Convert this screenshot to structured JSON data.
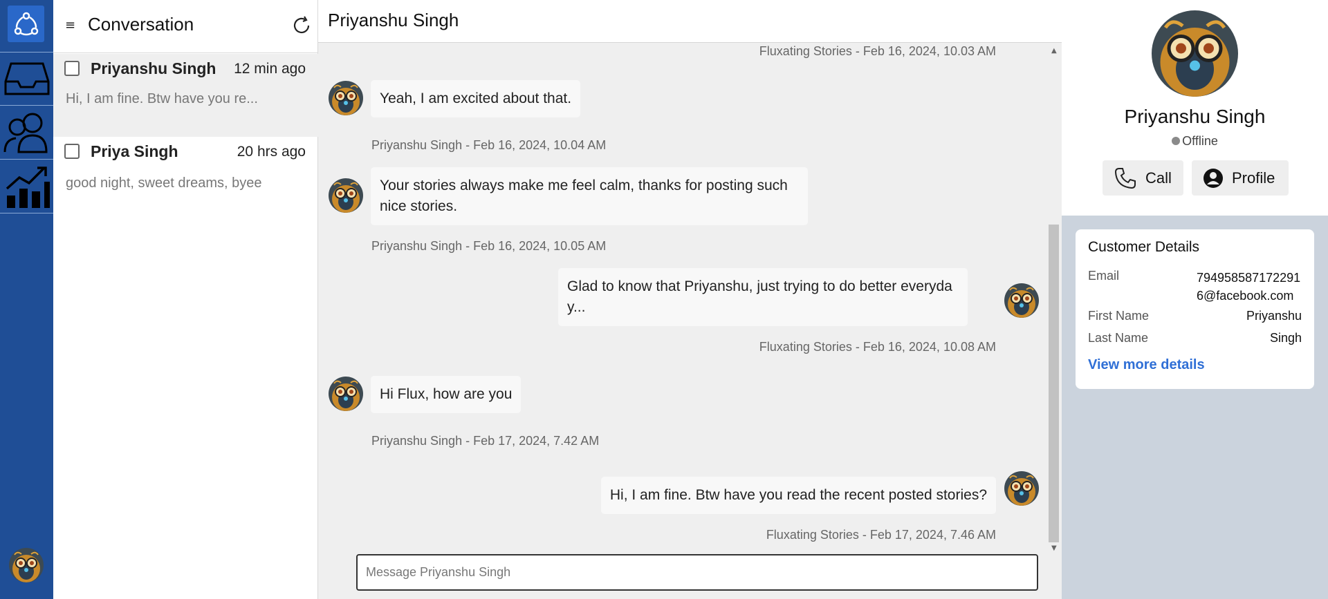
{
  "conversation_list": {
    "title": "Conversation",
    "items": [
      {
        "name": "Priyanshu Singh",
        "time": "12 min ago",
        "preview": "Hi, I am fine. Btw have you re..."
      },
      {
        "name": "Priya Singh",
        "time": "20 hrs ago",
        "preview": "good night, sweet dreams, byee"
      }
    ]
  },
  "chat": {
    "title": "Priyanshu Singh",
    "messages": [
      {
        "meta": "Fluxating Stories - Feb 16, 2024, 10.03 AM"
      },
      {
        "text": "Yeah, I am excited about that.",
        "meta": "Priyanshu Singh - Feb 16, 2024, 10.04 AM"
      },
      {
        "text": "Your stories always make me feel calm, thanks for posting such nice stories.",
        "meta": "Priyanshu Singh - Feb 16, 2024, 10.05 AM"
      },
      {
        "text": "Glad to know that Priyanshu, just trying to do better everyday...",
        "meta": "Fluxating Stories - Feb 16, 2024, 10.08 AM"
      },
      {
        "text": "Hi Flux, how are you",
        "meta": "Priyanshu Singh - Feb 17, 2024, 7.42 AM"
      },
      {
        "text": "Hi, I am fine. Btw have you read the recent posted stories?",
        "meta": "Fluxating Stories - Feb 17, 2024, 7.46 AM"
      }
    ],
    "composer_placeholder": "Message Priyanshu Singh"
  },
  "profile": {
    "name": "Priyanshu Singh",
    "status": "Offline",
    "call_label": "Call",
    "profile_label": "Profile"
  },
  "customer_details": {
    "title": "Customer Details",
    "email_label": "Email",
    "email_value": "7949585871722916@facebook.com",
    "first_name_label": "First Name",
    "first_name_value": "Priyanshu",
    "last_name_label": "Last Name",
    "last_name_value": "Singh",
    "link": "View more details"
  },
  "colors": {
    "rail": "#1f4e96",
    "accent_link": "#2f6fd6",
    "chat_bg": "#efefef",
    "side_bg": "#cbd3dd"
  },
  "icons": [
    "logo-icon",
    "inbox-icon",
    "contacts-icon",
    "analytics-icon",
    "menu-icon",
    "refresh-icon",
    "phone-icon",
    "user-circle-icon"
  ]
}
